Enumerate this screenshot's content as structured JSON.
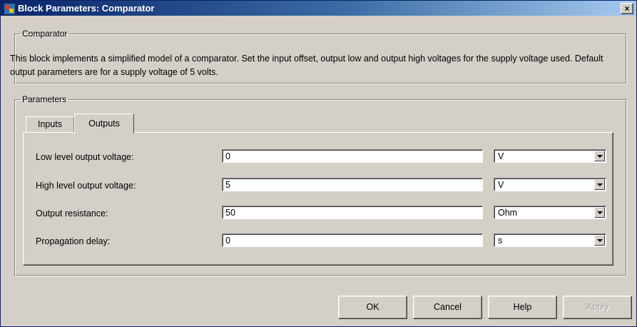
{
  "window": {
    "title": "Block Parameters: Comparator",
    "close_label": "×"
  },
  "comparator": {
    "legend": "Comparator",
    "description": "This block implements a simplified model of a comparator. Set the input offset, output low and output high voltages for the supply voltage used. Default output parameters are for a supply voltage of 5 volts."
  },
  "parameters": {
    "legend": "Parameters",
    "tabs": [
      {
        "label": "Inputs",
        "selected": false
      },
      {
        "label": "Outputs",
        "selected": true
      }
    ],
    "rows": [
      {
        "label": "Low level output voltage:",
        "value": "0",
        "unit": "V"
      },
      {
        "label": "High level output voltage:",
        "value": "5",
        "unit": "V"
      },
      {
        "label": "Output resistance:",
        "value": "50",
        "unit": "Ohm"
      },
      {
        "label": "Propagation delay:",
        "value": "0",
        "unit": "s"
      }
    ]
  },
  "buttons": {
    "ok": "OK",
    "cancel": "Cancel",
    "help": "Help",
    "apply": "Apply"
  }
}
